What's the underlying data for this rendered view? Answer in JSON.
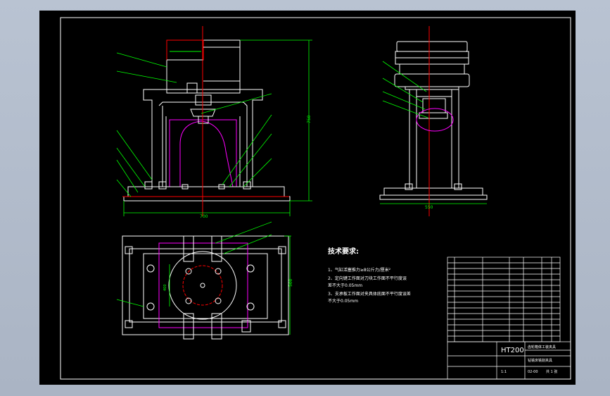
{
  "drawing": {
    "tech_title": "技术要求:",
    "tech_notes": [
      "1、气缸活塞推力≥8公斤力/厘米²",
      "2、定向键工作面对刀块工作面不平行度误",
      "差不大于0.05mm",
      "3、支承板工作面对夹具体底面不平行度误差",
      "不大于0.05mm"
    ],
    "dims": {
      "height": "750",
      "width_front": "700",
      "width_side": "550",
      "plan_depth": "500",
      "plan_inner": "400"
    },
    "title_block": {
      "material": "HT200",
      "name_line1": "齿轮箱体工装夹具",
      "name_line2": "钻铣床铣削夹具",
      "drawing_no": "02-00",
      "scale": "1:1",
      "sheet": "共 1 张"
    }
  }
}
